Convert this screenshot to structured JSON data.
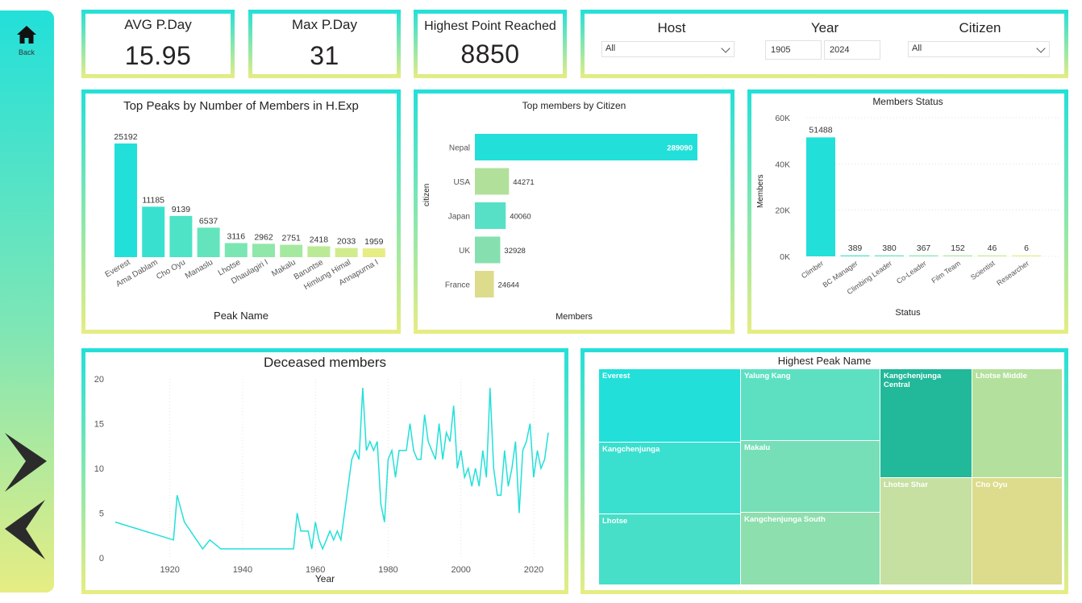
{
  "sidebar": {
    "back_label": "Back"
  },
  "kpis": [
    {
      "title": "AVG P.Day",
      "value": "15.95"
    },
    {
      "title": "Max P.Day",
      "value": "31"
    },
    {
      "title": "Highest Point Reached",
      "value": "8850"
    }
  ],
  "filters": {
    "host": {
      "title": "Host",
      "value": "All"
    },
    "year": {
      "title": "Year",
      "from": "1905",
      "to": "2024"
    },
    "citizen": {
      "title": "Citizen",
      "value": "All"
    }
  },
  "colors": {
    "primary": "#22e0d9",
    "accent_yellow": "#e6ed83",
    "treemap_dark": "#22b89a"
  },
  "chart_data": [
    {
      "type": "bar",
      "title": "Top Peaks by Number of Members in H.Exp",
      "xlabel": "Peak Name",
      "categories": [
        "Everest",
        "Ama Dablam",
        "Cho Oyu",
        "Manaslu",
        "Lhotse",
        "Dhaulagiri I",
        "Makalu",
        "Baruntse",
        "Himlung Himal",
        "Annapurna I"
      ],
      "values": [
        25192,
        11185,
        9139,
        6537,
        3116,
        2962,
        2751,
        2418,
        2033,
        1959
      ],
      "ylim": [
        0,
        25192
      ]
    },
    {
      "type": "bar",
      "orientation": "horizontal",
      "title": "Top members by Citizen",
      "xlabel": "Members",
      "ylabel": "citizen",
      "categories": [
        "Nepal",
        "USA",
        "Japan",
        "UK",
        "France"
      ],
      "values": [
        289090,
        44271,
        40060,
        32928,
        24644
      ]
    },
    {
      "type": "bar",
      "title": "Members Status",
      "xlabel": "Status",
      "ylabel": "Members",
      "categories": [
        "Climber",
        "BC Manager",
        "Climbing Leader",
        "Co-Leader",
        "Film Team",
        "Scientist",
        "Researcher"
      ],
      "values": [
        51488,
        389,
        380,
        367,
        152,
        46,
        6
      ],
      "yticks": [
        "0K",
        "20K",
        "40K",
        "60K"
      ],
      "ylim": [
        0,
        60000
      ],
      "grid": true
    },
    {
      "type": "line",
      "title": "Deceased members",
      "xlabel": "Year",
      "xticks": [
        1920,
        1940,
        1960,
        1980,
        2000,
        2020
      ],
      "yticks": [
        0,
        5,
        10,
        15,
        20
      ],
      "xlim": [
        1905,
        2024
      ],
      "ylim": [
        0,
        20
      ],
      "x": [
        1905,
        1921,
        1922,
        1924,
        1929,
        1931,
        1934,
        1954,
        1955,
        1956,
        1957,
        1958,
        1959,
        1960,
        1961,
        1962,
        1963,
        1964,
        1965,
        1966,
        1967,
        1968,
        1969,
        1970,
        1971,
        1972,
        1973,
        1974,
        1975,
        1976,
        1977,
        1978,
        1979,
        1980,
        1981,
        1982,
        1983,
        1984,
        1985,
        1986,
        1987,
        1988,
        1989,
        1990,
        1991,
        1992,
        1993,
        1994,
        1995,
        1996,
        1997,
        1998,
        1999,
        2000,
        2001,
        2002,
        2003,
        2004,
        2005,
        2006,
        2007,
        2008,
        2009,
        2010,
        2011,
        2012,
        2013,
        2014,
        2015,
        2016,
        2017,
        2018,
        2019,
        2020,
        2021,
        2022,
        2023,
        2024
      ],
      "values": [
        4,
        2,
        7,
        4,
        1,
        2,
        1,
        1,
        5,
        3,
        3,
        3,
        1,
        4,
        2,
        1,
        2,
        3,
        2,
        3,
        2,
        5,
        8,
        11,
        12,
        11,
        19,
        12,
        13,
        12,
        13,
        6,
        4,
        11,
        12,
        9,
        12,
        12,
        12,
        15,
        12,
        11,
        11,
        16,
        13,
        12,
        11,
        15,
        11,
        14,
        13,
        17,
        10,
        12,
        9,
        10,
        8,
        10,
        8,
        12,
        9,
        19,
        10,
        7,
        7,
        12,
        8,
        10,
        13,
        5,
        12,
        13,
        15,
        9,
        12,
        10,
        11,
        14,
        11
      ]
    }
  ],
  "deceased_labels": {
    "title": "Deceased members",
    "xlabel": "Year"
  },
  "treemap": {
    "title": "Highest Peak Name",
    "items": [
      {
        "label": "Everest"
      },
      {
        "label": "Kangchenjunga"
      },
      {
        "label": "Lhotse"
      },
      {
        "label": "Yalung Kang"
      },
      {
        "label": "Makalu"
      },
      {
        "label": "Kangchenjunga South"
      },
      {
        "label": "Kangchenjunga Central"
      },
      {
        "label": "Lhotse Shar"
      },
      {
        "label": "Lhotse Middle"
      },
      {
        "label": "Cho Oyu"
      }
    ]
  }
}
